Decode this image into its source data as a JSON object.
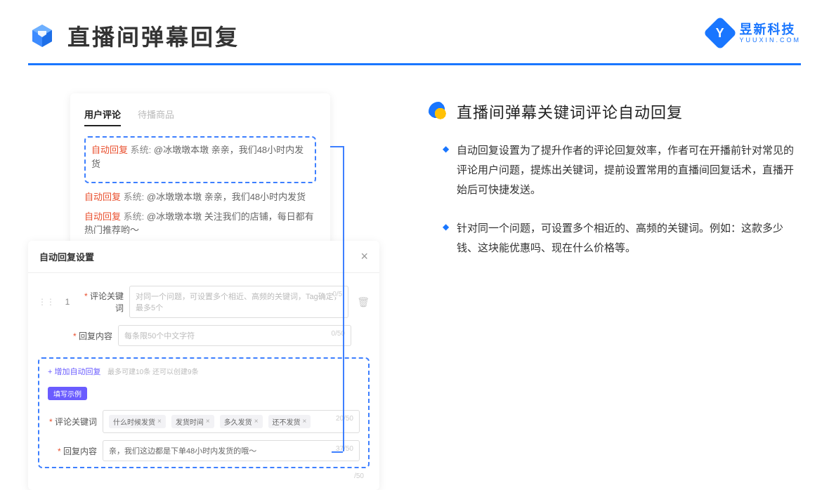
{
  "header": {
    "title": "直播间弹幕回复"
  },
  "brand": {
    "cn": "昱新科技",
    "en": "YUUXIN.COM"
  },
  "comments": {
    "tabs": [
      "用户评论",
      "待播商品"
    ],
    "auto_label": "自动回复",
    "sys_label": "系统:",
    "msg1": "@冰墩墩本墩 亲亲，我们48小时内发货",
    "msg2": "@冰墩墩本墩 亲亲，我们48小时内发货",
    "msg3": "@冰墩墩本墩 关注我们的店铺，每日都有热门推荐哟～"
  },
  "settings": {
    "title": "自动回复设置",
    "idx": "1",
    "kw_label": "评论关键词",
    "kw_placeholder": "对同一个问题，可设置多个相近、高频的关键词，Tag确定，最多5个",
    "kw_count": "0/5",
    "content_label": "回复内容",
    "content_placeholder": "每条限50个中文字符",
    "content_count": "0/50",
    "add_link": "+ 增加自动回复",
    "add_hint": "最多可建10条 还可以创建9条",
    "badge": "填写示例",
    "ex_kw_label": "评论关键词",
    "ex_tags": [
      "什么时候发货",
      "发货时间",
      "多久发货",
      "还不发货"
    ],
    "ex_kw_count": "20/50",
    "ex_content_label": "回复内容",
    "ex_content": "亲，我们这边都是下单48小时内发货的哦～",
    "ex_content_count": "37/50",
    "tail_count": "/50"
  },
  "right": {
    "title": "直播间弹幕关键词评论自动回复",
    "b1": "自动回复设置为了提升作者的评论回复效率，作者可在开播前针对常见的评论用户问题，提炼出关键词，提前设置常用的直播间回复话术，直播开始后可快捷发送。",
    "b2": "针对同一个问题，可设置多个相近的、高频的关键词。例如：这款多少钱、这块能优惠吗、现在什么价格等。"
  }
}
